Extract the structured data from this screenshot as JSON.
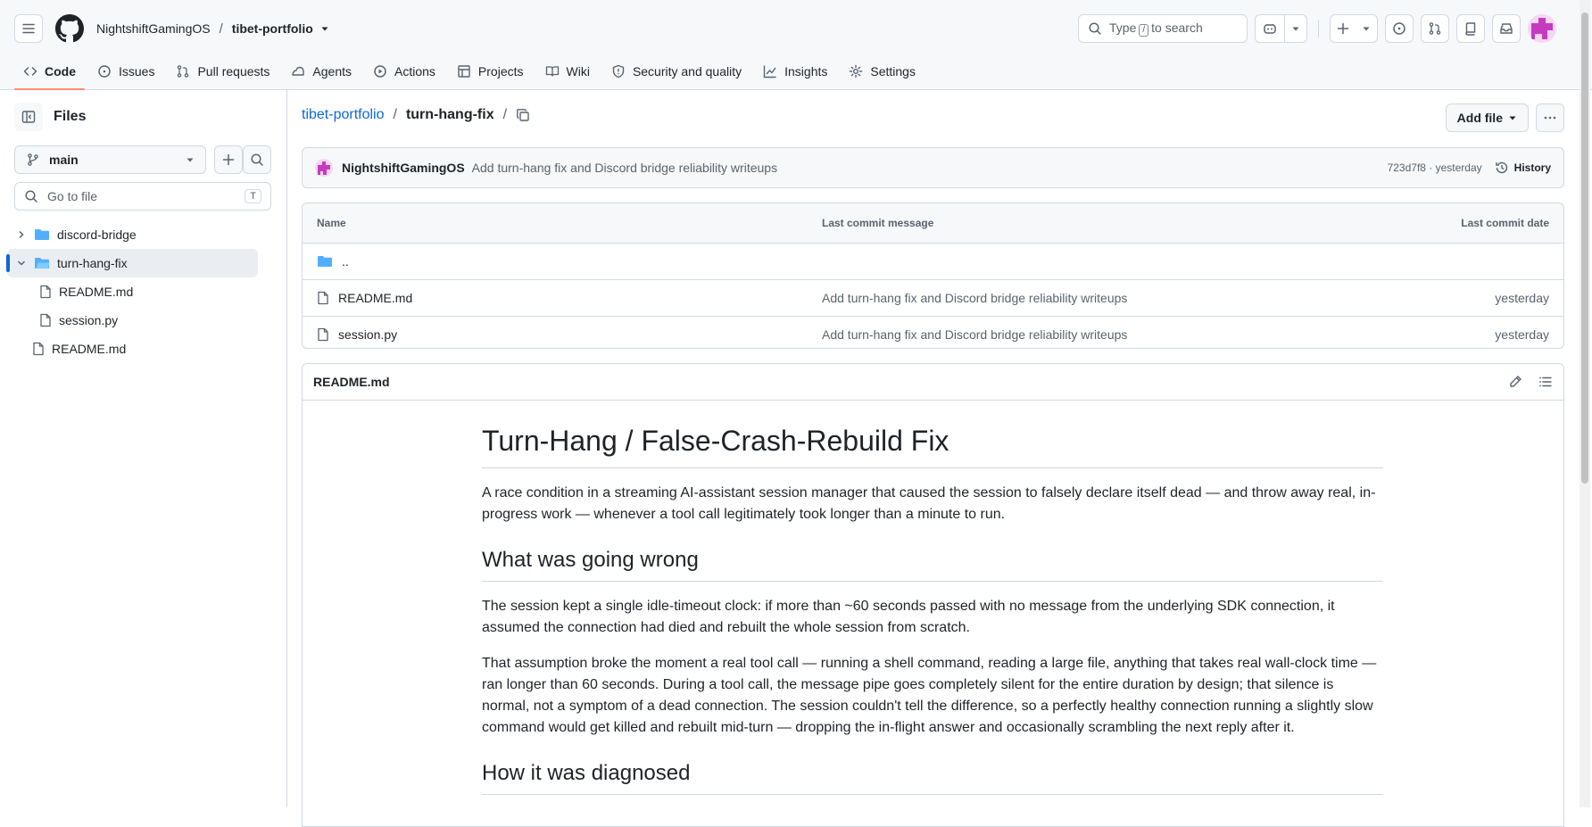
{
  "header": {
    "owner": "NightshiftGamingOS",
    "separator": "/",
    "repo": "tibet-portfolio",
    "search": {
      "prefix": "Type",
      "key": "/",
      "suffix": "to search"
    }
  },
  "tabs": [
    {
      "label": "Code",
      "icon": "code-icon",
      "active": true
    },
    {
      "label": "Issues",
      "icon": "issue-icon"
    },
    {
      "label": "Pull requests",
      "icon": "pull-request-icon"
    },
    {
      "label": "Agents",
      "icon": "agents-icon"
    },
    {
      "label": "Actions",
      "icon": "play-icon"
    },
    {
      "label": "Projects",
      "icon": "table-icon"
    },
    {
      "label": "Wiki",
      "icon": "book-icon"
    },
    {
      "label": "Security and quality",
      "icon": "shield-icon"
    },
    {
      "label": "Insights",
      "icon": "graph-icon"
    },
    {
      "label": "Settings",
      "icon": "gear-icon"
    }
  ],
  "sidebar": {
    "title": "Files",
    "branch": "main",
    "goto_placeholder": "Go to file",
    "goto_key": "T",
    "tree": [
      {
        "label": "discord-bridge",
        "type": "folder",
        "expanded": false
      },
      {
        "label": "turn-hang-fix",
        "type": "folder",
        "expanded": true,
        "selected": true
      },
      {
        "label": "README.md",
        "type": "file",
        "child": true
      },
      {
        "label": "session.py",
        "type": "file",
        "child": true
      },
      {
        "label": "README.md",
        "type": "file"
      }
    ]
  },
  "path": {
    "repo": "tibet-portfolio",
    "sep": "/",
    "current": "turn-hang-fix",
    "trail": "/"
  },
  "actions": {
    "add_file": "Add file"
  },
  "commit": {
    "author": "NightshiftGamingOS",
    "message": "Add turn-hang fix and Discord bridge reliability writeups",
    "meta": "723d7f8 · yesterday",
    "history": "History"
  },
  "files": {
    "headers": {
      "name": "Name",
      "message": "Last commit message",
      "date": "Last commit date"
    },
    "rows": [
      {
        "name": "..",
        "type": "folder",
        "message": "",
        "date": ""
      },
      {
        "name": "README.md",
        "type": "file",
        "message": "Add turn-hang fix and Discord bridge reliability writeups",
        "date": "yesterday"
      },
      {
        "name": "session.py",
        "type": "file",
        "message": "Add turn-hang fix and Discord bridge reliability writeups",
        "date": "yesterday"
      }
    ]
  },
  "readme": {
    "filename": "README.md",
    "h1": "Turn-Hang / False-Crash-Rebuild Fix",
    "intro": "A race condition in a streaming AI-assistant session manager that caused the session to falsely declare itself dead — and throw away real, in-progress work — whenever a tool call legitimately took longer than a minute to run.",
    "h2_wrong": "What was going wrong",
    "p1": "The session kept a single idle-timeout clock: if more than ~60 seconds passed with no message from the underlying SDK connection, it assumed the connection had died and rebuilt the whole session from scratch.",
    "p2": "That assumption broke the moment a real tool call — running a shell command, reading a large file, anything that takes real wall-clock time — ran longer than 60 seconds. During a tool call, the message pipe goes completely silent for the entire duration by design; that silence is normal, not a symptom of a dead connection. The session couldn't tell the difference, so a perfectly healthy connection running a slightly slow command would get killed and rebuilt mid-turn — dropping the in-flight answer and occasionally scrambling the next reply after it.",
    "h2_diag": "How it was diagnosed"
  },
  "colors": {
    "accent": "#0969da",
    "tab_underline": "#fd8c73",
    "folder": "#54aeff"
  }
}
